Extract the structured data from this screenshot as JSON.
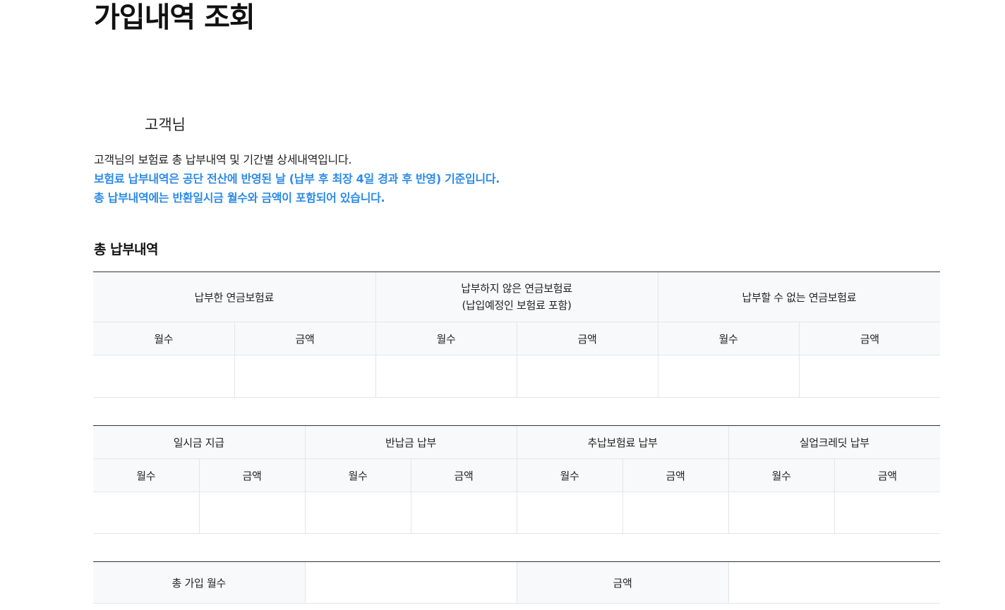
{
  "page": {
    "title": "가입내역 조회",
    "customer_label": "고객님"
  },
  "description": {
    "line1": "고객님의 보험료 총 납부내역 및 기간별 상세내역입니다.",
    "note1": "보험료 납부내역은 공단 전산에 반영된 날 (납부 후 최장 4일 경과 후 반영) 기준입니다.",
    "note2": "총 납부내역에는 반환일시금 월수와 금액이 포함되어 있습니다."
  },
  "colors": {
    "note_blue": "#2b8ae8",
    "header_bg": "#f8f9fa",
    "top_border": "#333333",
    "grid_line": "#e3e5e8"
  },
  "total_section": {
    "title": "총 납부내역",
    "table1": {
      "groups": [
        "납부한 연금보험료",
        "납부하지 않은 연금보험료",
        "(납입예정인 보험료 포함)",
        "납부할 수 없는 연금보험료"
      ],
      "months_label": "월수",
      "amount_label": "금액"
    },
    "table2": {
      "groups": [
        "일시금 지급",
        "반납금 납부",
        "추납보험료 납부",
        "실업크레딧 납부"
      ],
      "months_label": "월수",
      "amount_label": "금액"
    },
    "table3": {
      "total_months_label": "총 가입 월수",
      "amount_label": "금액"
    }
  }
}
